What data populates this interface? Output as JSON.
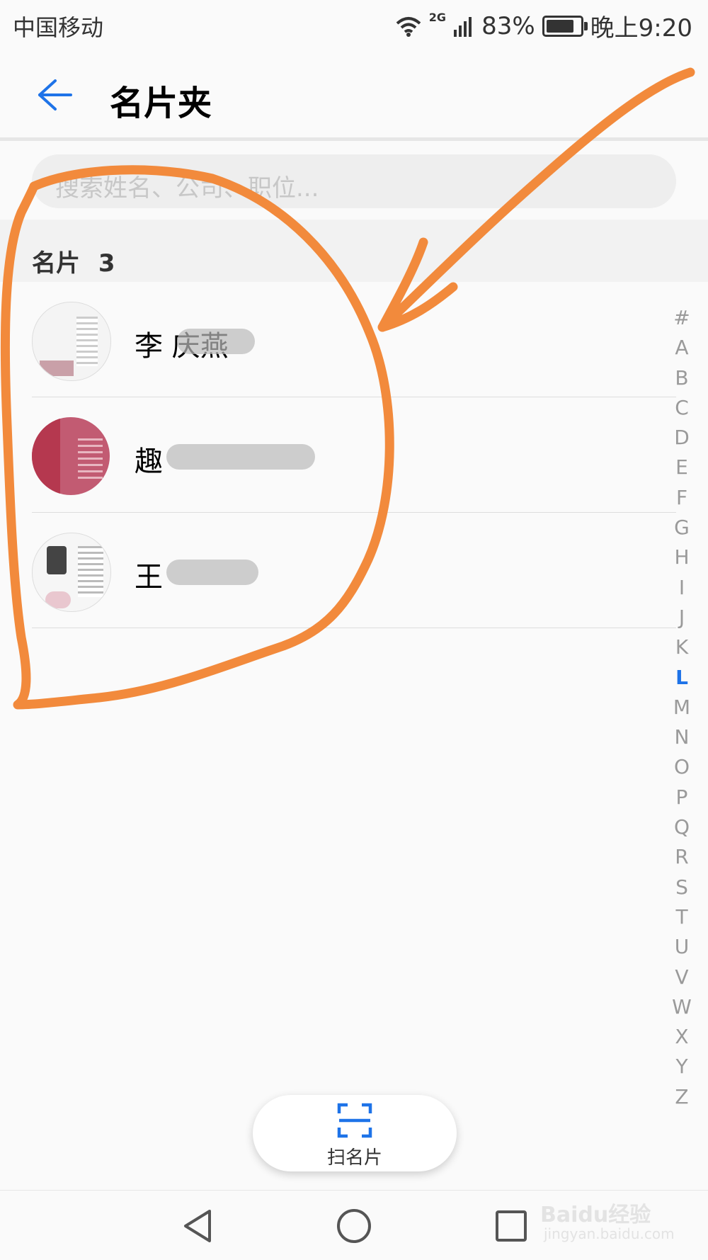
{
  "status_bar": {
    "carrier": "中国移动",
    "network": "2G",
    "battery_text": "83%",
    "battery_level": 0.83,
    "time": "晚上9:20",
    "icons": [
      "wifi-icon",
      "signal-icon",
      "battery-icon"
    ]
  },
  "header": {
    "back_icon": "arrow-left-icon",
    "title": "名片夹"
  },
  "search": {
    "placeholder": "搜索姓名、公司、职位..."
  },
  "section": {
    "label": "名片",
    "count": "3"
  },
  "contacts": [
    {
      "name": "李 庆燕"
    },
    {
      "name": "趣"
    },
    {
      "name": "王"
    }
  ],
  "index_letters": [
    "#",
    "A",
    "B",
    "C",
    "D",
    "E",
    "F",
    "G",
    "H",
    "I",
    "J",
    "K",
    "L",
    "M",
    "N",
    "O",
    "P",
    "Q",
    "R",
    "S",
    "T",
    "U",
    "V",
    "W",
    "X",
    "Y",
    "Z"
  ],
  "active_index": "L",
  "scan_button": {
    "label": "扫名片",
    "icon": "scan-frame-icon"
  },
  "nav_bar": {
    "icons": [
      "nav-back-icon",
      "nav-home-icon",
      "nav-recents-icon"
    ]
  },
  "watermark": {
    "brand": "Baidu经验",
    "url": "jingyan.baidu.com"
  },
  "colors": {
    "accent": "#1e73e8",
    "annotation": "#f28a3c"
  }
}
